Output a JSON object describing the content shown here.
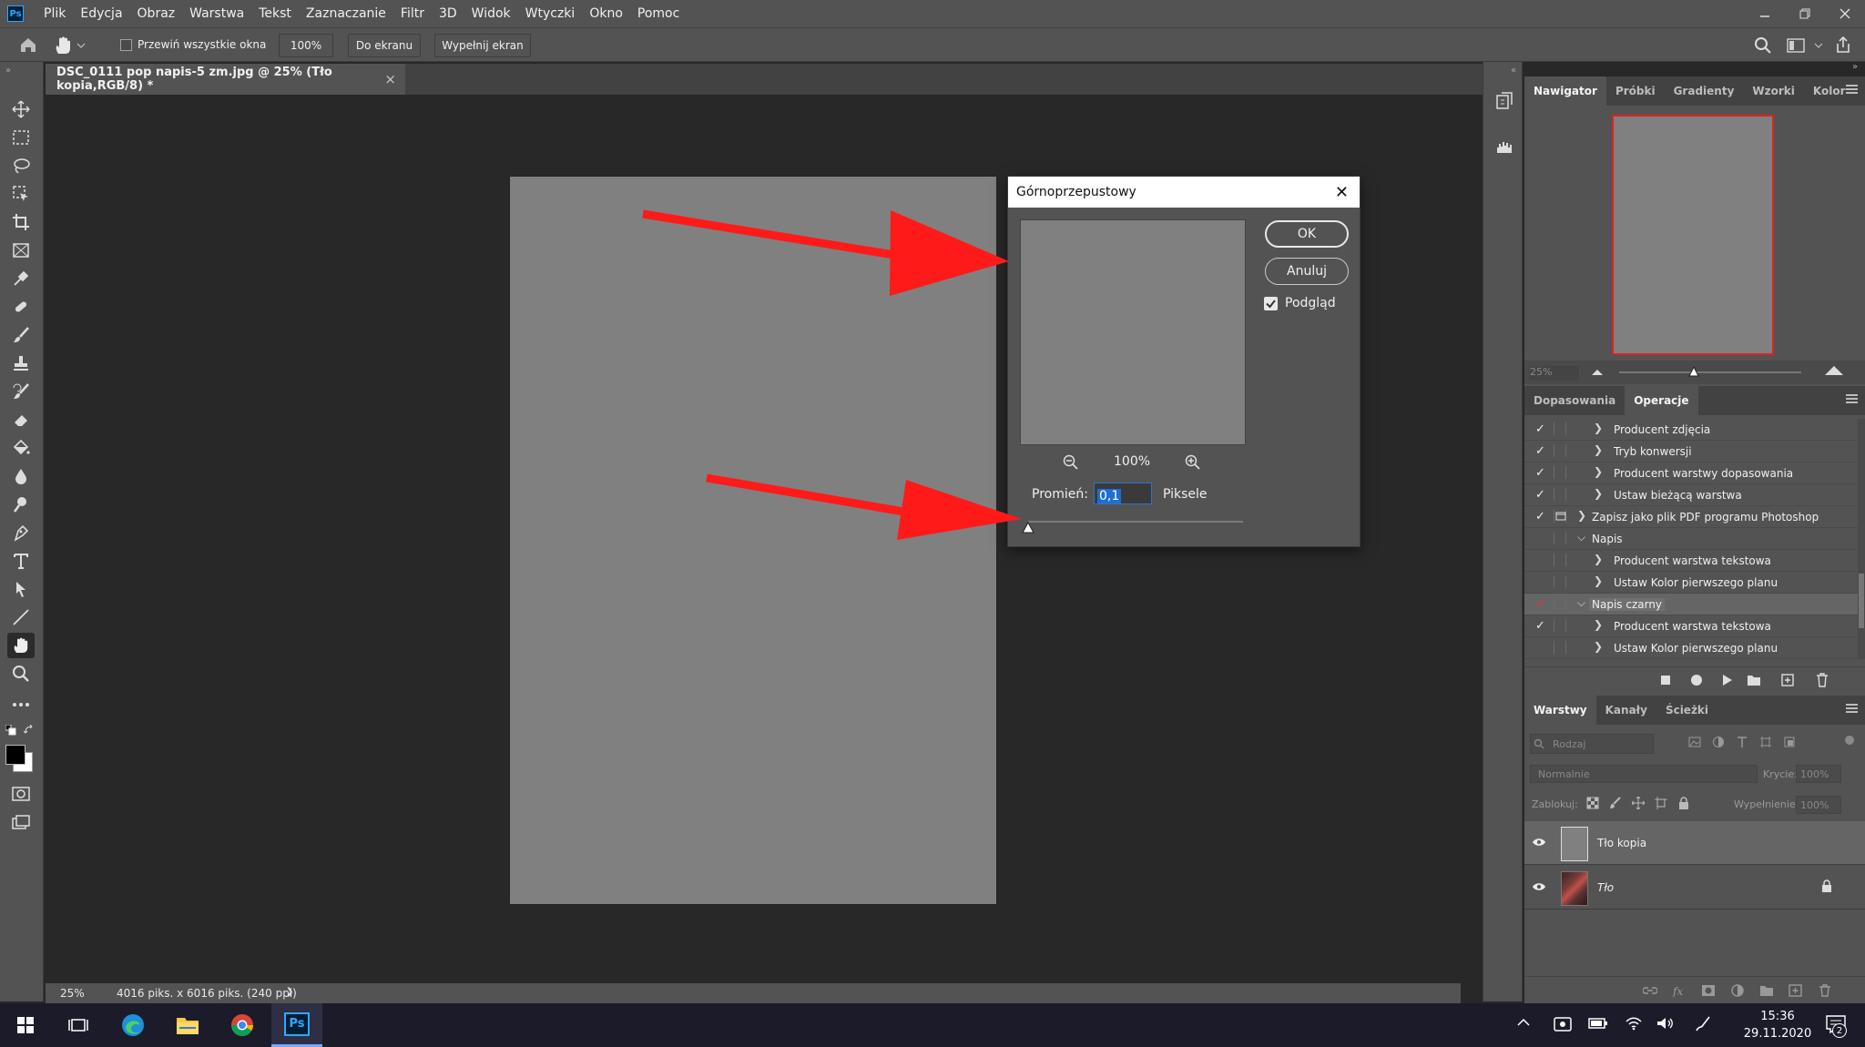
{
  "app": {
    "logo": "Ps",
    "menu": [
      "Plik",
      "Edycja",
      "Obraz",
      "Warstwa",
      "Tekst",
      "Zaznaczanie",
      "Filtr",
      "3D",
      "Widok",
      "Wtyczki",
      "Okno",
      "Pomoc"
    ]
  },
  "options": {
    "scroll_all_label": "Przewiń wszystkie okna",
    "zoom_btn": "100%",
    "fit_btn": "Do ekranu",
    "fill_btn": "Wypełnij ekran"
  },
  "document": {
    "tab_title": "DSC_0111 pop napis-5 zm.jpg @ 25% (Tło kopia,RGB/8) *",
    "close": "×"
  },
  "status": {
    "zoom": "25%",
    "info": "4016 piks. x 6016 piks. (240 ppi)",
    "arrow": "❯"
  },
  "dialog": {
    "title": "Górnoprzepustowy",
    "close": "✕",
    "ok": "OK",
    "cancel": "Anuluj",
    "preview_label": "Podgląd",
    "preview_checked": true,
    "zoom": "100%",
    "radius_label": "Promień:",
    "radius_value": "0,1",
    "unit": "Piksele"
  },
  "navigator": {
    "tabs": [
      "Nawigator",
      "Próbki",
      "Gradienty",
      "Wzorki",
      "Kolor"
    ],
    "zoom": "25%"
  },
  "actions": {
    "tabs": [
      "Dopasowania",
      "Operacje"
    ],
    "rows": [
      {
        "check": "✓",
        "indent": 2,
        "toggle": "❯",
        "label": "Producent zdjęcia",
        "dialog": false,
        "highlight": false,
        "red": false
      },
      {
        "check": "✓",
        "indent": 2,
        "toggle": "❯",
        "label": "Tryb konwersji",
        "dialog": false,
        "highlight": false,
        "red": false
      },
      {
        "check": "✓",
        "indent": 2,
        "toggle": "❯",
        "label": "Producent warstwy dopasowania",
        "dialog": false,
        "highlight": false,
        "red": false
      },
      {
        "check": "✓",
        "indent": 2,
        "toggle": "❯",
        "label": "Ustaw bieżącą warstwa",
        "dialog": false,
        "highlight": false,
        "red": false
      },
      {
        "check": "✓",
        "indent": 1,
        "toggle": "❯",
        "label": "Zapisz jako plik PDF programu Photoshop",
        "dialog": true,
        "highlight": false,
        "red": false
      },
      {
        "check": "",
        "indent": 1,
        "toggle": "⌵",
        "label": "Napis",
        "dialog": false,
        "highlight": false,
        "red": false
      },
      {
        "check": "",
        "indent": 2,
        "toggle": "❯",
        "label": "Producent warstwa tekstowa",
        "dialog": false,
        "highlight": false,
        "red": false
      },
      {
        "check": "",
        "indent": 2,
        "toggle": "❯",
        "label": "Ustaw Kolor pierwszego planu",
        "dialog": false,
        "highlight": false,
        "red": false
      },
      {
        "check": "✓",
        "indent": 1,
        "toggle": "⌵",
        "label": "Napis czarny",
        "dialog": false,
        "highlight": true,
        "red": true
      },
      {
        "check": "✓",
        "indent": 2,
        "toggle": "❯",
        "label": "Producent warstwa tekstowa",
        "dialog": false,
        "highlight": false,
        "red": false
      },
      {
        "check": "",
        "indent": 2,
        "toggle": "❯",
        "label": "Ustaw Kolor pierwszego planu",
        "dialog": false,
        "highlight": false,
        "red": false
      }
    ]
  },
  "layers": {
    "tabs": [
      "Warstwy",
      "Kanały",
      "Ścieżki"
    ],
    "filter_placeholder": "Rodzaj",
    "blend_mode": "Normalnie",
    "opacity_label": "Krycie:",
    "opacity": "100%",
    "lock_label": "Zablokuj:",
    "fill_label": "Wypełnienie:",
    "fill": "100%",
    "items": [
      {
        "name": "Tło kopia",
        "italic": false,
        "selected": true,
        "locked": false
      },
      {
        "name": "Tło",
        "italic": true,
        "selected": false,
        "locked": true
      }
    ]
  },
  "taskbar": {
    "time": "15:36",
    "date": "29.11.2020",
    "notifications": "2",
    "ps_label": "Ps"
  },
  "colors": {
    "arrow": "#ff1a1a",
    "accent": "#31a8ff"
  }
}
